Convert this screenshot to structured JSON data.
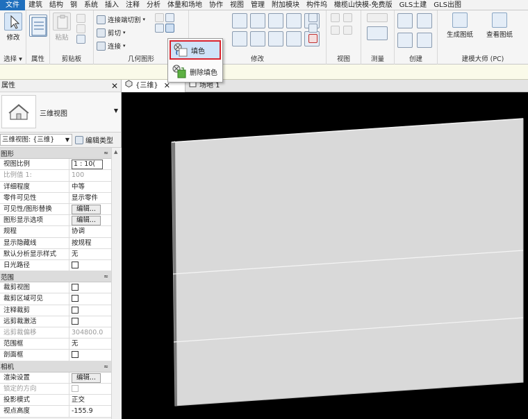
{
  "menu": {
    "tabs": [
      "文件",
      "建筑",
      "结构",
      "钢",
      "系统",
      "插入",
      "注释",
      "分析",
      "体量和场地",
      "协作",
      "视图",
      "管理",
      "附加模块",
      "构件坞",
      "橄榄山快模-免费版",
      "GLS土建",
      "GLS出图"
    ]
  },
  "ribbon": {
    "modify_label": "修改",
    "paste_label": "粘贴",
    "geometry_items": {
      "cope": "连接端切割",
      "cut": "剪切",
      "join": "连接"
    },
    "panels": {
      "select": "选择",
      "properties": "属性",
      "clipboard": "剪贴板",
      "geometry": "几何图形",
      "modify": "修改",
      "view": "视图",
      "measure": "测量",
      "create": "创建",
      "olive": "建模大师 (PC)"
    },
    "olive_buttons": {
      "generate": "生成图纸",
      "view_drawings": "查看图纸"
    }
  },
  "dropdown": {
    "paint": "填色",
    "remove_paint": "删除填色"
  },
  "properties_palette": {
    "title": "属性",
    "type_name": "三维视图",
    "instance_selector": "三维视图: {三维}",
    "edit_type": "编辑类型",
    "sections": [
      {
        "name": "图形",
        "rows": [
          {
            "k": "视图比例",
            "v": "1 : 10(",
            "kind": "input"
          },
          {
            "k": "比例值 1:",
            "v": "100",
            "kind": "ro"
          },
          {
            "k": "详细程度",
            "v": "中等",
            "kind": "text"
          },
          {
            "k": "零件可见性",
            "v": "显示零件",
            "kind": "text"
          },
          {
            "k": "可见性/图形替换",
            "v": "编辑...",
            "kind": "button"
          },
          {
            "k": "图形显示选项",
            "v": "编辑...",
            "kind": "button"
          },
          {
            "k": "规程",
            "v": "协调",
            "kind": "text"
          },
          {
            "k": "显示隐藏线",
            "v": "按规程",
            "kind": "text"
          },
          {
            "k": "默认分析显示样式",
            "v": "无",
            "kind": "text"
          },
          {
            "k": "日光路径",
            "v": "",
            "kind": "check"
          }
        ]
      },
      {
        "name": "范围",
        "rows": [
          {
            "k": "裁剪视图",
            "v": "",
            "kind": "check"
          },
          {
            "k": "裁剪区域可见",
            "v": "",
            "kind": "check"
          },
          {
            "k": "注释裁剪",
            "v": "",
            "kind": "check"
          },
          {
            "k": "远剪裁激活",
            "v": "",
            "kind": "check"
          },
          {
            "k": "远剪裁偏移",
            "v": "304800.0",
            "kind": "ro"
          },
          {
            "k": "范围框",
            "v": "无",
            "kind": "text"
          },
          {
            "k": "剖面框",
            "v": "",
            "kind": "check"
          }
        ]
      },
      {
        "name": "相机",
        "rows": [
          {
            "k": "渲染设置",
            "v": "编辑...",
            "kind": "button"
          },
          {
            "k": "锁定的方向",
            "v": "",
            "kind": "check-ro"
          },
          {
            "k": "投影模式",
            "v": "正交",
            "kind": "text"
          },
          {
            "k": "视点高度",
            "v": "-155.9",
            "kind": "text"
          }
        ]
      }
    ]
  },
  "view_tabs": {
    "active": "{三维}",
    "inactive": "场地 1"
  },
  "icons": {
    "view3d": "house-icon",
    "paint": "paint-bucket-icon",
    "remove_paint": "remove-paint-icon"
  },
  "colors": {
    "file_tab": "#1f6fbd",
    "highlight_border": "#d9232e",
    "viewport_bg": "#000000",
    "wall": "#d9d9d9"
  }
}
